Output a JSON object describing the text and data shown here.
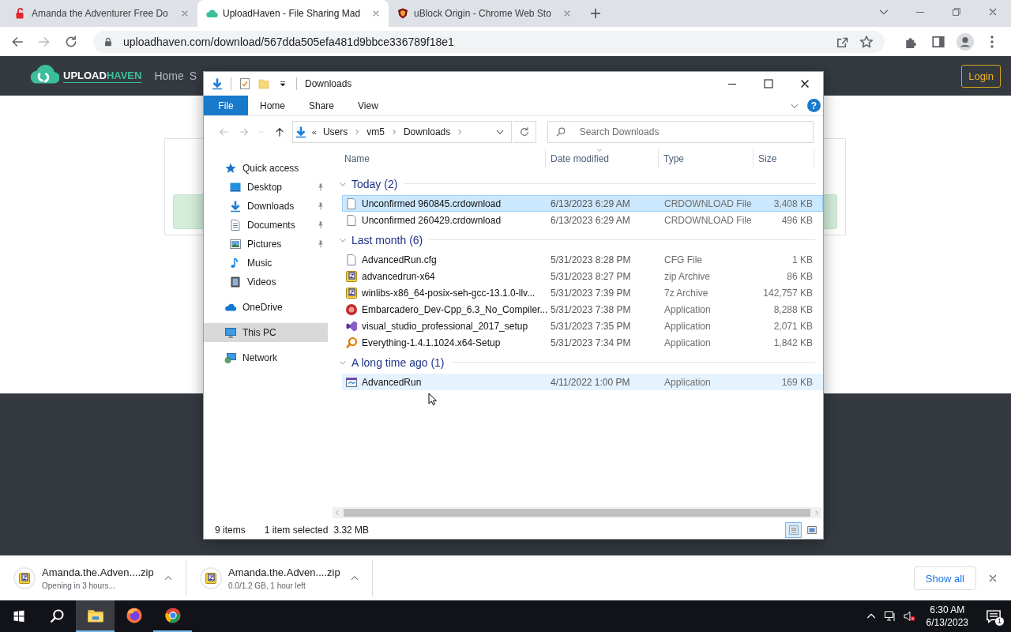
{
  "browser": {
    "tabs": [
      {
        "title": "Amanda the Adventurer Free Do",
        "kind": "lock",
        "selected": false
      },
      {
        "title": "UploadHaven - File Sharing Mad",
        "kind": "cloud",
        "selected": true
      },
      {
        "title": "uBlock Origin - Chrome Web Sto",
        "kind": "shield",
        "selected": false
      }
    ],
    "address": "uploadhaven.com/download/567dda505efa481d9bbce336789f18e1"
  },
  "site": {
    "logo": {
      "first": "UPLOAD",
      "second": "HAVEN"
    },
    "nav": [
      "Home",
      "S"
    ],
    "login": "Login"
  },
  "explorer": {
    "title": "Downloads",
    "ribbon_tabs": [
      {
        "label": "File",
        "selected": true
      },
      {
        "label": "Home",
        "selected": false
      },
      {
        "label": "Share",
        "selected": false
      },
      {
        "label": "View",
        "selected": false
      }
    ],
    "help": "?",
    "overflow": "«",
    "path": [
      "Users",
      "vm5",
      "Downloads"
    ],
    "search": {
      "placeholder": "Search Downloads"
    },
    "sidebar": [
      {
        "label": "Quick access",
        "kind": "star",
        "selected": false,
        "children": [
          {
            "label": "Desktop",
            "kind": "desktop",
            "pinned": true,
            "selected": false
          },
          {
            "label": "Downloads",
            "kind": "download",
            "pinned": true,
            "selected": false
          },
          {
            "label": "Documents",
            "kind": "documents",
            "pinned": true,
            "selected": false
          },
          {
            "label": "Pictures",
            "kind": "pictures",
            "pinned": true,
            "selected": false
          },
          {
            "label": "Music",
            "kind": "music",
            "pinned": false,
            "selected": false
          },
          {
            "label": "Videos",
            "kind": "videos",
            "pinned": false,
            "selected": false
          }
        ]
      },
      {
        "label": "OneDrive",
        "kind": "onedrive",
        "selected": false
      },
      {
        "label": "This PC",
        "kind": "pc",
        "selected": true
      },
      {
        "label": "Network",
        "kind": "network",
        "selected": false
      }
    ],
    "columns": [
      "Name",
      "Date modified",
      "Type",
      "Size"
    ],
    "groups": [
      {
        "label": "Today (2)",
        "expanded": true,
        "files": [
          {
            "name": "Unconfirmed 960845.crdownload",
            "date": "6/13/2023 6:29 AM",
            "type": "CRDOWNLOAD File",
            "size": "3,408 KB",
            "kind": "doc",
            "selected": true,
            "hovered": false
          },
          {
            "name": "Unconfirmed 260429.crdownload",
            "date": "6/13/2023 6:29 AM",
            "type": "CRDOWNLOAD File",
            "size": "496 KB",
            "kind": "doc",
            "selected": false,
            "hovered": false
          }
        ]
      },
      {
        "label": "Last month (6)",
        "expanded": true,
        "files": [
          {
            "name": "AdvancedRun.cfg",
            "date": "5/31/2023 8:28 PM",
            "type": "CFG File",
            "size": "1 KB",
            "kind": "doc",
            "selected": false,
            "hovered": false
          },
          {
            "name": "advancedrun-x64",
            "date": "5/31/2023 8:27 PM",
            "type": "zip Archive",
            "size": "86 KB",
            "kind": "zip",
            "selected": false,
            "hovered": false
          },
          {
            "name": "winlibs-x86_64-posix-seh-gcc-13.1.0-llv...",
            "date": "5/31/2023 7:39 PM",
            "type": "7z Archive",
            "size": "142,757 KB",
            "kind": "zip",
            "selected": false,
            "hovered": false
          },
          {
            "name": "Embarcadero_Dev-Cpp_6.3_No_Compiler...",
            "date": "5/31/2023 7:38 PM",
            "type": "Application",
            "size": "8,288 KB",
            "kind": "dev",
            "selected": false,
            "hovered": false
          },
          {
            "name": "visual_studio_professional_2017_setup",
            "date": "5/31/2023 7:35 PM",
            "type": "Application",
            "size": "2,071 KB",
            "kind": "vs",
            "selected": false,
            "hovered": false
          },
          {
            "name": "Everything-1.4.1.1024.x64-Setup",
            "date": "5/31/2023 7:34 PM",
            "type": "Application",
            "size": "1,842 KB",
            "kind": "magnifier",
            "selected": false,
            "hovered": false
          }
        ]
      },
      {
        "label": "A long time ago (1)",
        "expanded": true,
        "files": [
          {
            "name": "AdvancedRun",
            "date": "4/11/2022 1:00 PM",
            "type": "Application",
            "size": "169 KB",
            "kind": "app",
            "selected": false,
            "hovered": true
          }
        ]
      }
    ],
    "status": {
      "count": "9 items",
      "selection": "1 item selected",
      "selection_size": "3.32 MB"
    },
    "views": [
      {
        "kind": "details",
        "selected": true
      },
      {
        "kind": "large-icons",
        "selected": false
      }
    ]
  },
  "downloads": {
    "items": [
      {
        "name": "Amanda.the.Adven....zip",
        "status": "Opening in 3 hours..."
      },
      {
        "name": "Amanda.the.Adven....zip",
        "status": "0.0/1.2 GB, 1 hour left"
      }
    ],
    "show_all": "Show all"
  },
  "taskbar": {
    "apps": [
      {
        "kind": "explorer",
        "running": true,
        "active": true
      },
      {
        "kind": "firefox",
        "running": false,
        "active": false
      },
      {
        "kind": "chrome",
        "running": true,
        "active": false
      }
    ],
    "time": "6:30 AM",
    "date": "6/13/2023",
    "notifications": "1"
  }
}
